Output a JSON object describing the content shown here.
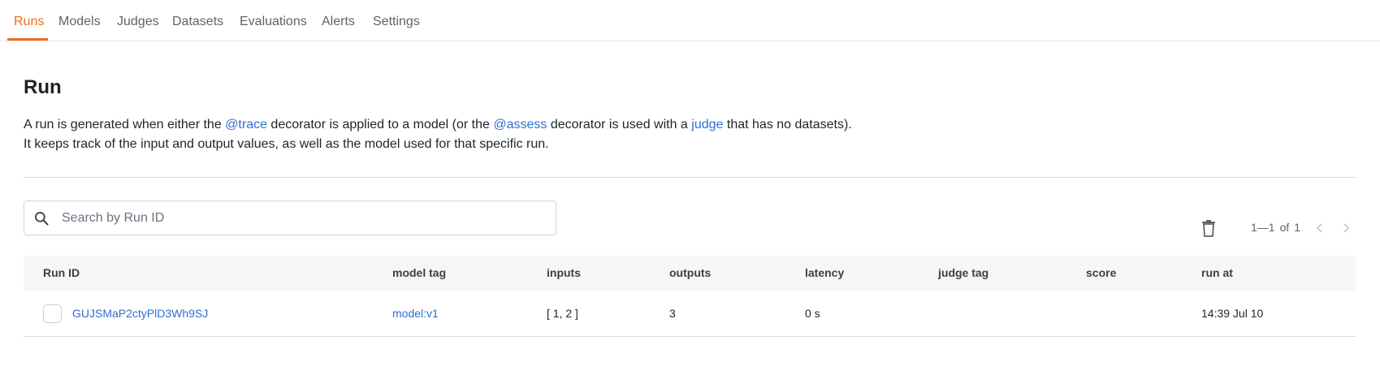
{
  "nav": {
    "tabs": [
      {
        "label": "Runs",
        "active": true
      },
      {
        "label": "Models"
      },
      {
        "label": "Judges"
      },
      {
        "label": "Datasets"
      },
      {
        "label": "Evaluations"
      },
      {
        "label": "Alerts"
      },
      {
        "label": "Settings"
      }
    ]
  },
  "page": {
    "title": "Run",
    "description": {
      "line1": {
        "t1": "A run is generated when either the ",
        "link1": "@trace",
        "t2": " decorator is applied to a model (or the ",
        "link2": "@assess",
        "t3": " decorator is used with a ",
        "link3": "judge",
        "t4": " that has no datasets)."
      },
      "line2": "It keeps track of the input and output values, as well as the model used for that specific run."
    }
  },
  "search": {
    "placeholder": "Search by Run ID",
    "value": ""
  },
  "pagination": {
    "range": "1—1",
    "of_label": "of",
    "total": "1"
  },
  "table": {
    "columns": [
      "Run ID",
      "model tag",
      "inputs",
      "outputs",
      "latency",
      "judge tag",
      "score",
      "run at"
    ],
    "rows": [
      {
        "run_id": "GUJSMaP2ctyPlD3Wh9SJ",
        "model_tag": "model:v1",
        "inputs": "[ 1, 2 ]",
        "outputs": "3",
        "latency": "0 s",
        "judge_tag": "",
        "score": "",
        "run_at": "14:39 Jul 10"
      }
    ]
  },
  "colors": {
    "accent": "#f26b1d",
    "link": "#2f6fd0"
  },
  "icons": {
    "search": "search-icon",
    "delete": "trash-icon",
    "prev": "chevron-left-icon",
    "next": "chevron-right-icon"
  }
}
